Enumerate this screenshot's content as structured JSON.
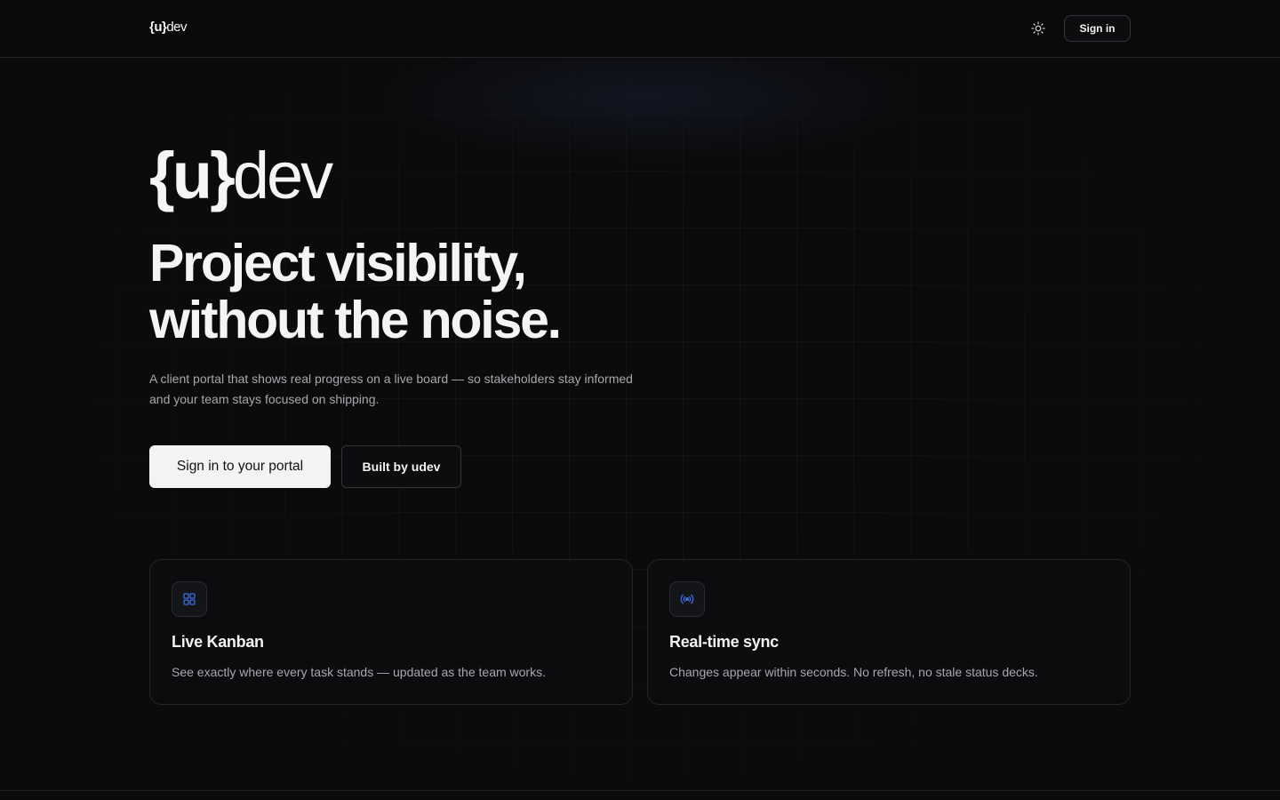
{
  "header": {
    "logo_brace": "{u}",
    "logo_dev": "dev",
    "theme_icon": "sun-icon",
    "signin_label": "Sign in"
  },
  "hero": {
    "logo_brace": "{u}",
    "logo_dev": "dev",
    "headline_line1": "Project visibility,",
    "headline_line2": "without the noise.",
    "subtitle_line1": "A client portal that shows real progress on a live board — so stakeholders stay informed",
    "subtitle_line2": "and your team stays focused on shipping.",
    "primary_cta": "Sign in to your portal",
    "secondary_cta": "Built by udev"
  },
  "features": [
    {
      "icon": "grid-icon",
      "title": "Live Kanban",
      "description": "See exactly where every task stands — updated as the team works."
    },
    {
      "icon": "broadcast-icon",
      "title": "Real-time sync",
      "description": "Changes appear within seconds. No refresh, no stale status decks."
    }
  ],
  "colors": {
    "background": "#0b0b0c",
    "accent_icon": "#3b6fe0",
    "text_primary": "#f2f2f2",
    "text_muted": "#a7a8ad"
  }
}
